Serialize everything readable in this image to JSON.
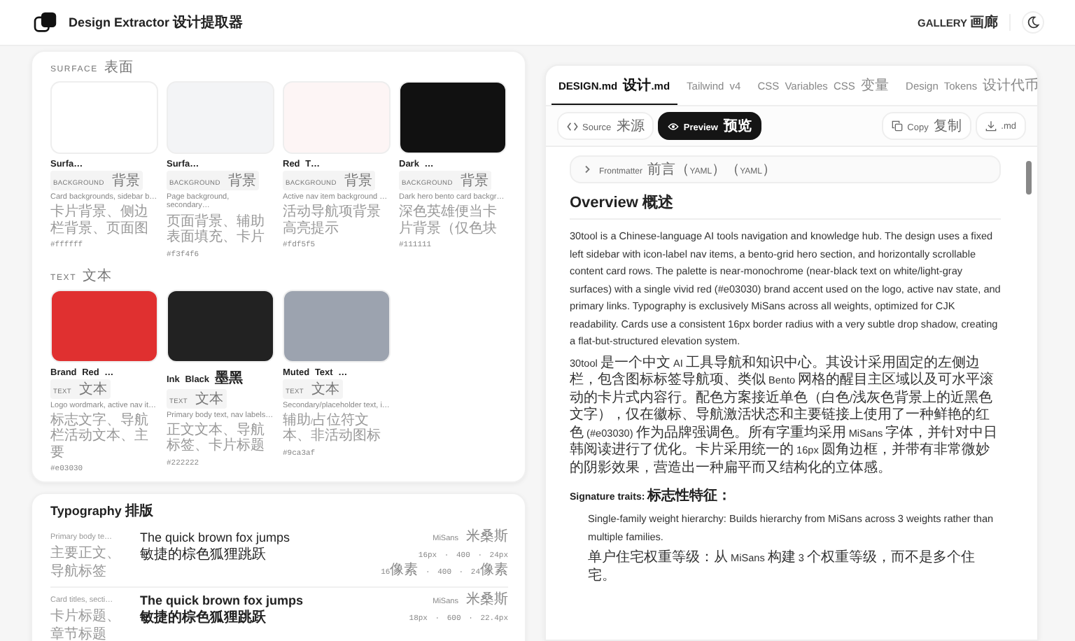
{
  "header": {
    "title": "Design Extractor 设计提取器",
    "nav_link": "GALLERY 画廊"
  },
  "colors": {
    "sections": [
      {
        "label": "SURFACE 表面",
        "swatches": [
          {
            "name": "Surfa…",
            "category": "BACKGROUND 背景",
            "description": "Card backgrounds, sidebar b…",
            "description_cn": "卡片背景、侧边栏背景、页面图",
            "hex": "#ffffff",
            "color": "#ffffff"
          },
          {
            "name": "Surfa…",
            "category": "BACKGROUND 背景",
            "description": "Page background, secondary…",
            "description_cn": "页面背景、辅助表面填充、卡片",
            "hex": "#f3f4f6",
            "color": "#f3f4f6"
          },
          {
            "name": "Red T…",
            "category": "BACKGROUND 背景",
            "description": "Active nav item background …",
            "description_cn": "活动导航项背景高亮提示",
            "hex": "#fdf5f5",
            "color": "#fdf5f5"
          },
          {
            "name": "Dark …",
            "category": "BACKGROUND 背景",
            "description": "Dark hero bento card backgr…",
            "description_cn": "深色英雄便当卡片背景（仅色块",
            "hex": "#111111",
            "color": "#111111"
          }
        ]
      },
      {
        "label": "TEXT 文本",
        "swatches": [
          {
            "name": "Brand Red …",
            "category": "TEXT 文本",
            "description": "Logo wordmark, active nav it…",
            "description_cn": "标志文字、导航栏活动文本、主要",
            "hex": "#e03030",
            "color": "#e03030"
          },
          {
            "name": "Ink Black 墨黑",
            "category": "TEXT 文本",
            "description": "Primary body text, nav labels…",
            "description_cn": "正文文本、导航标签、卡片标题",
            "hex": "#222222",
            "color": "#222222"
          },
          {
            "name": "Muted Text …",
            "category": "TEXT 文本",
            "description": "Secondary/placeholder text, i…",
            "description_cn": "辅助/占位符文本、非活动图标",
            "hex": "#9ca3af",
            "color": "#9ca3af"
          }
        ]
      }
    ]
  },
  "typography": {
    "title": "Typography 排版",
    "rows": [
      {
        "label": "Primary body te…",
        "label_cn": "主要正文、导航标签",
        "sample": "The quick brown fox jumps",
        "sample_cn": "敏捷的棕色狐狸跳跃",
        "bold": false,
        "family": "MiSans 米桑斯",
        "spec": "16px · 400 · 24px",
        "spec_cn": "16像素 · 400 · 24像素"
      },
      {
        "label": "Card titles, secti…",
        "label_cn": "卡片标题、章节标题",
        "sample": "The quick brown fox jumps",
        "sample_cn": "敏捷的棕色狐狸跳跃",
        "bold": true,
        "family": "MiSans 米桑斯",
        "spec": "18px · 600 · 22.4px"
      }
    ]
  },
  "panel": {
    "tabs": [
      {
        "label": "DESIGN.md 设计.md",
        "selected": true
      },
      {
        "label": "Tailwind v4",
        "selected": false
      },
      {
        "label": "CSS Variables CSS 变量",
        "selected": false
      },
      {
        "label": "Design Tokens 设计代币",
        "selected": false
      }
    ],
    "view_modes": [
      {
        "label": "Source 来源",
        "selected": false
      },
      {
        "label": "Preview 预览",
        "selected": true
      }
    ],
    "actions": [
      "Copy 复制",
      ".md"
    ],
    "document": {
      "frontmatter": {
        "label": "Frontmatter 前言（YAML）（YAML）",
        "expanded": false
      },
      "heading": "Overview 概述",
      "paragraphs": [
        "30tool is a Chinese-language AI tools navigation and knowledge hub. The design uses a fixed left sidebar with icon-label nav items, a bento-grid hero section, and horizontally scrollable content card rows. The palette is near-monochrome (near-black text on white/light-gray surfaces) with a single vivid red (#e03030) brand accent used on the logo, active nav state, and primary links. Typography is exclusively MiSans across all weights, optimized for CJK readability. Cards use a consistent 16px border radius with a very subtle drop shadow, creating a flat-but-structured elevation system.",
        "30tool 是一个中文 AI 工具导航和知识中心。其设计采用固定的左侧边栏，包含图标标签导航项、类似 Bento 网格的醒目主区域以及可水平滚动的卡片式内容行。配色方案接近单色（白色/浅灰色背景上的近黑色文字），仅在徽标、导航激活状态和主要链接上使用了一种鲜艳的红色 (#e03030) 作为品牌强调色。所有字重均采用 MiSans 字体，并针对中日韩阅读进行了优化。卡片采用统一的 16px 圆角边框，并带有非常微妙的阴影效果，营造出一种扁平而又结构化的立体感。"
      ],
      "subheading": "Signature traits: 标志性特征：",
      "traits": [
        {
          "text": "Single-family weight hierarchy: Builds hierarchy from MiSans across 3 weights rather than multiple families.",
          "text_cn": "单户住宅权重等级：从 MiSans 构建 3 个权重等级，而不是多个住宅。"
        }
      ]
    }
  }
}
